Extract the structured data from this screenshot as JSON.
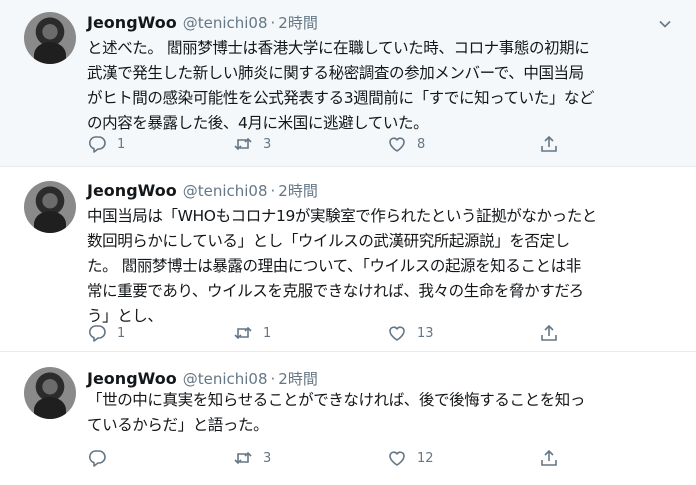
{
  "tweets": [
    {
      "name": "JeongWoo",
      "handle": "@tenichi08",
      "separator": "·",
      "time": "2時間",
      "text": "と述べた。 閻丽梦博士は香港大学に在職していた時、コロナ事態の初期に\n武漢で発生した新しい肺炎に関する秘密調査の参加メンバーで、中国当局\nがヒト間の感染可能性を公式発表する3週間前に「すでに知っていた」など\nの内容を暴露した後、4月に米国に逃避していた。",
      "reply_count": "1",
      "retweet_count": "3",
      "like_count": "8",
      "icons": [
        "reply-icon",
        "retweet-icon",
        "like-icon",
        "share-icon",
        "chevron-down-icon"
      ]
    },
    {
      "name": "JeongWoo",
      "handle": "@tenichi08",
      "separator": "·",
      "time": "2時間",
      "text": "中国当局は「WHOもコロナ19が実験室で作られたという証拠がなかったと\n数回明らかにしている」とし「ウイルスの武漢研究所起源説」を否定し\nた。 閻丽梦博士は暴露の理由について、「ウイルスの起源を知ることは非\n常に重要であり、ウイルスを克服できなければ、我々の生命を脅かすだろ\nう」とし、",
      "reply_count": "1",
      "retweet_count": "1",
      "like_count": "13",
      "icons": [
        "reply-icon",
        "retweet-icon",
        "like-icon",
        "share-icon"
      ]
    },
    {
      "name": "JeongWoo",
      "handle": "@tenichi08",
      "separator": "·",
      "time": "2時間",
      "text": "「世の中に真実を知らせることができなければ、後で後悔することを知っ\nているからだ」と語った。",
      "reply_count": "",
      "retweet_count": "3",
      "like_count": "12",
      "icons": [
        "reply-icon",
        "retweet-icon",
        "like-icon",
        "share-icon"
      ]
    }
  ]
}
